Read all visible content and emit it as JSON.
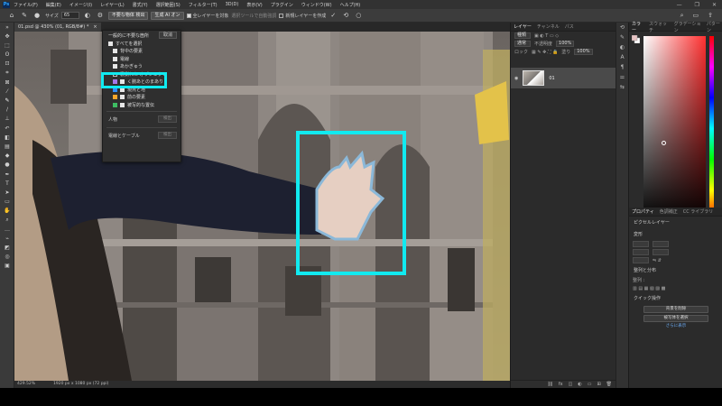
{
  "menubar": {
    "logo": "Ps",
    "items": [
      "ファイル(F)",
      "編集(E)",
      "イメージ(I)",
      "レイヤー(L)",
      "書式(Y)",
      "選択範囲(S)",
      "フィルター(T)",
      "3D(D)",
      "表示(V)",
      "プラグイン",
      "ウィンドウ(W)",
      "ヘルプ(H)"
    ],
    "window_controls": [
      "—",
      "❐",
      "✕"
    ]
  },
  "optionsbar": {
    "size_label": "サイズ",
    "size_value": "65",
    "select_subject_btn": "不要な物体 検出",
    "generate_btn": "生成 AI オン",
    "sample_all_label": "全レイヤーを対象",
    "enhance_edge_label": "選択ツールで自動強調",
    "new_layer_label": "新規レイヤーを作成"
  },
  "document": {
    "tab_title": "01.psd @ 430% (01, RGB/8#) *",
    "status_zoom": "429.52%",
    "status_size": "1920 px x 1080 px (72 ppi)"
  },
  "popup": {
    "title": "一般的に不要な箇所",
    "cancel_label": "取消",
    "select_all_label": "すべてを選択",
    "items": [
      {
        "label": "背中の要素",
        "checked": true
      },
      {
        "label": "電線",
        "checked": true
      },
      {
        "label": "あかぎゅう",
        "checked": true
      },
      {
        "label": "裏側れた オブジェクト",
        "checked": false,
        "highlighted": true
      }
    ],
    "colored_items": [
      {
        "label": "く腕あとのまあり",
        "color": "#a777e8"
      },
      {
        "label": "現点と地",
        "color": "#2f8fff"
      },
      {
        "label": "前の要素",
        "color": "#f6a62b"
      },
      {
        "label": "被写的な置伝",
        "color": "#3dbd63"
      }
    ],
    "person_label": "人物",
    "person_btn": "検出",
    "wire_label": "電線とケーブル",
    "wire_btn": "検出"
  },
  "layers_panel": {
    "tabs": [
      "レイヤー",
      "チャンネル",
      "パス"
    ],
    "kind_label": "種類",
    "blend_mode": "通常",
    "opacity_label": "不透明度",
    "opacity_value": "100%",
    "lock_label": "ロック",
    "fill_label": "塗り",
    "fill_value": "100%",
    "layer_name": "01"
  },
  "color_panel": {
    "tabs": [
      "カラー",
      "スウォッチ",
      "グラデーション",
      "パターン"
    ]
  },
  "properties_panel": {
    "tabs": [
      "プロパティ",
      "色調補正",
      "CC ライブラリ"
    ],
    "pixel_layer_label": "ピクセルレイヤー",
    "transform_title": "変形",
    "align_title": "整列と分布",
    "align_label": "整列 :",
    "quick_actions_title": "クイック操作",
    "btn_remove_bg": "背景を削除",
    "btn_select_subject": "被写体を選択",
    "more_link": "さらに表示"
  },
  "colors": {
    "accent_cyan": "#11eaf0",
    "panel_bg": "#2b2b2b",
    "ps_blue": "#31a8ff"
  }
}
